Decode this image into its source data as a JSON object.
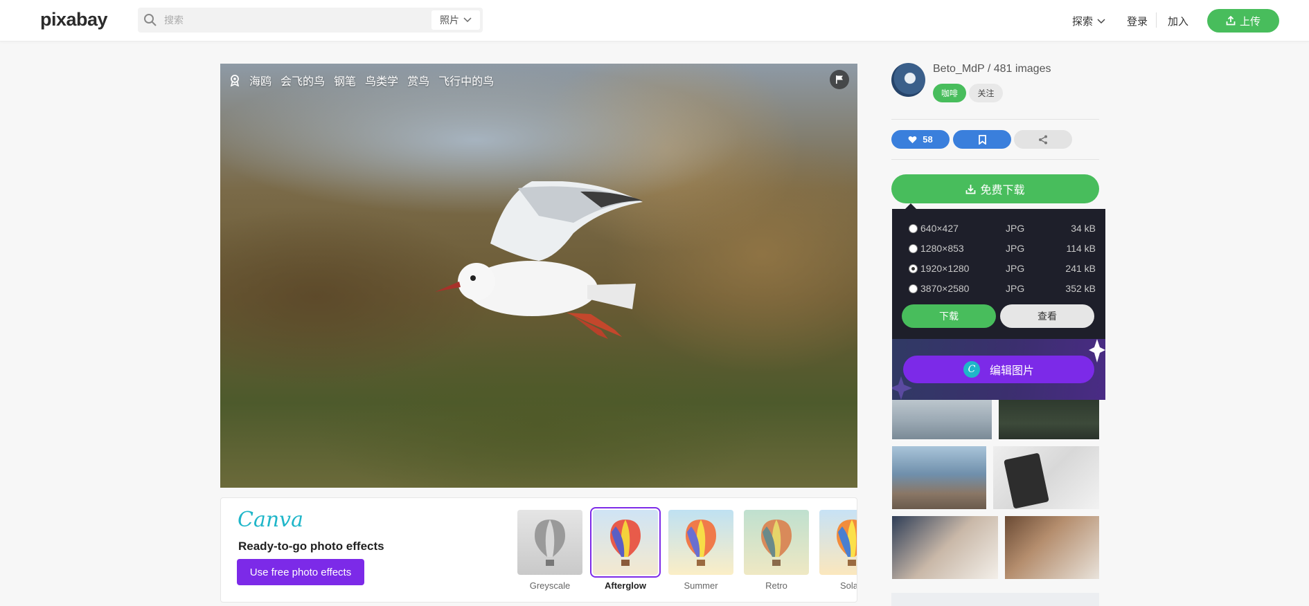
{
  "header": {
    "logo": "pixabay",
    "search_placeholder": "搜索",
    "search_type": "照片",
    "explore": "探索",
    "login": "登录",
    "join": "加入",
    "upload": "上传"
  },
  "photo": {
    "tags": [
      "海鸥",
      "会飞的鸟",
      "钢笔",
      "鸟类学",
      "赏鸟",
      "飞行中的鸟"
    ]
  },
  "canva": {
    "logo": "Canva",
    "title": "Ready-to-go photo effects",
    "button": "Use free photo effects",
    "effects": [
      {
        "label": "Greyscale",
        "selected": false
      },
      {
        "label": "Afterglow",
        "selected": true
      },
      {
        "label": "Summer",
        "selected": false
      },
      {
        "label": "Retro",
        "selected": false
      },
      {
        "label": "Sola",
        "selected": false
      }
    ]
  },
  "sidebar": {
    "author": "Beto_MdP / 481 images",
    "coffee": "咖啡",
    "follow": "关注",
    "likes": "58",
    "download_button": "免费下载",
    "download_options": [
      {
        "dimensions": "640×427",
        "format": "JPG",
        "size": "34 kB",
        "selected": false
      },
      {
        "dimensions": "1280×853",
        "format": "JPG",
        "size": "114 kB",
        "selected": false
      },
      {
        "dimensions": "1920×1280",
        "format": "JPG",
        "size": "241 kB",
        "selected": true
      },
      {
        "dimensions": "3870×2580",
        "format": "JPG",
        "size": "352 kB",
        "selected": false
      }
    ],
    "download": "下载",
    "view": "查看",
    "edit_image": "编辑图片",
    "canva_badge": "C"
  },
  "colors": {
    "brand_green": "#48bd5c",
    "action_blue": "#3a7fdc",
    "canva_purple": "#7c2ae8",
    "panel_dark": "#1e1f2a"
  }
}
